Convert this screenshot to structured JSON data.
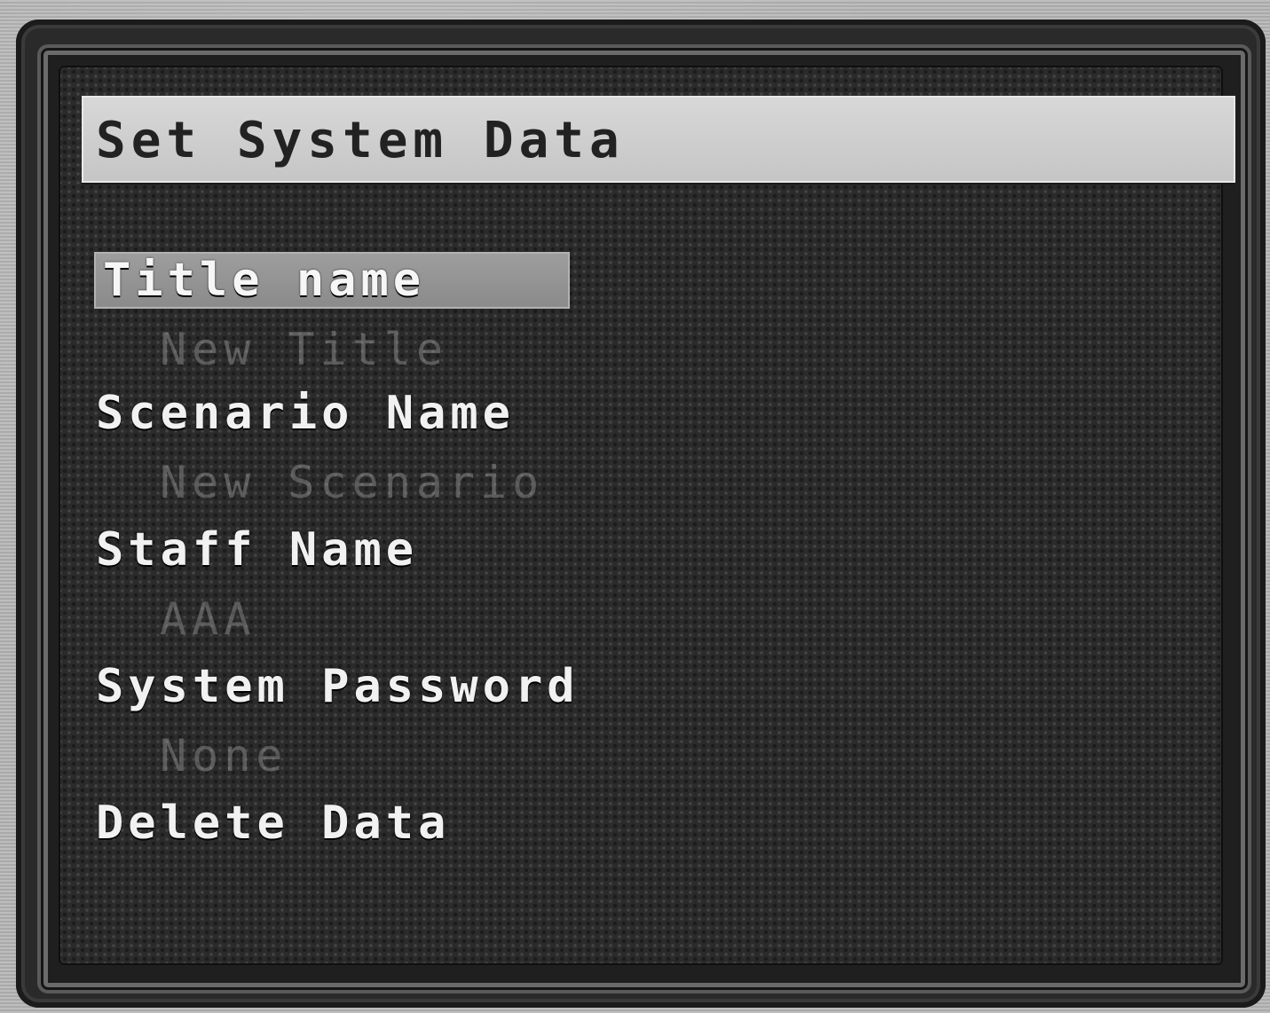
{
  "window": {
    "title": "Set System Data"
  },
  "menu": {
    "items": [
      {
        "label": "Title name",
        "value": "New Title",
        "selected": true
      },
      {
        "label": "Scenario Name",
        "value": "New Scenario",
        "selected": false
      },
      {
        "label": "Staff Name",
        "value": "AAA",
        "selected": false
      },
      {
        "label": "System Password",
        "value": "None",
        "selected": false
      },
      {
        "label": "Delete Data",
        "value": "",
        "selected": false
      }
    ]
  },
  "colors": {
    "background": "#2b2b2b",
    "title_bar": "#d0d0d0",
    "selected_item": "#959595",
    "text": "#f1f1f1",
    "subtext": "#7d7d7d"
  }
}
